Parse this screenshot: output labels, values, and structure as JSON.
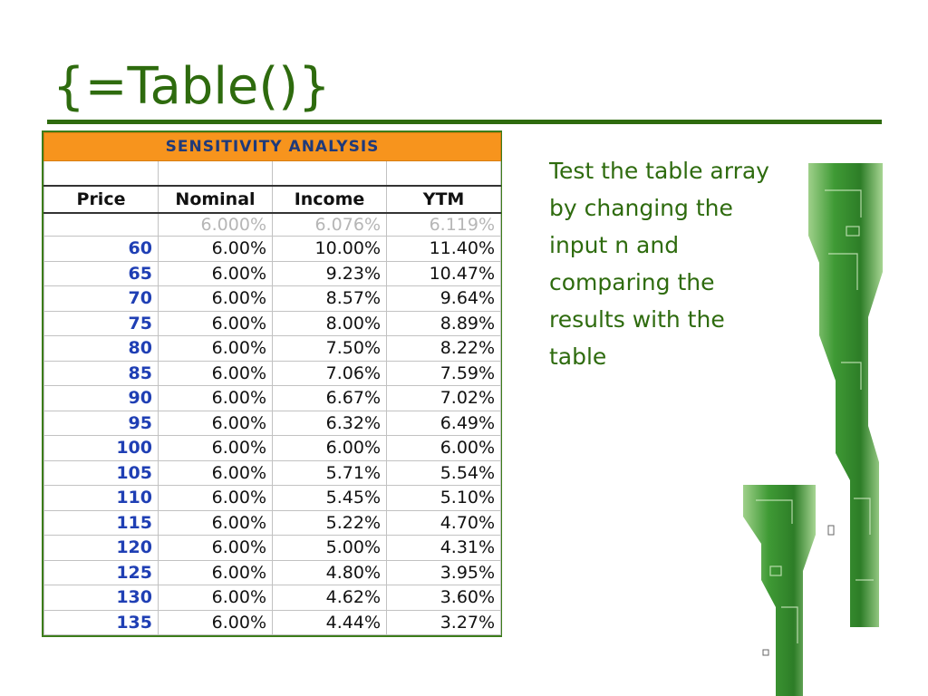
{
  "title": "{=Table()}",
  "table": {
    "banner": "SENSITIVITY ANALYSIS",
    "headers": [
      "Price",
      "Nominal",
      "Income",
      "YTM"
    ],
    "subrow": [
      "",
      "6.000%",
      "6.076%",
      "6.119%"
    ],
    "rows": [
      [
        "60",
        "6.00%",
        "10.00%",
        "11.40%"
      ],
      [
        "65",
        "6.00%",
        "9.23%",
        "10.47%"
      ],
      [
        "70",
        "6.00%",
        "8.57%",
        "9.64%"
      ],
      [
        "75",
        "6.00%",
        "8.00%",
        "8.89%"
      ],
      [
        "80",
        "6.00%",
        "7.50%",
        "8.22%"
      ],
      [
        "85",
        "6.00%",
        "7.06%",
        "7.59%"
      ],
      [
        "90",
        "6.00%",
        "6.67%",
        "7.02%"
      ],
      [
        "95",
        "6.00%",
        "6.32%",
        "6.49%"
      ],
      [
        "100",
        "6.00%",
        "6.00%",
        "6.00%"
      ],
      [
        "105",
        "6.00%",
        "5.71%",
        "5.54%"
      ],
      [
        "110",
        "6.00%",
        "5.45%",
        "5.10%"
      ],
      [
        "115",
        "6.00%",
        "5.22%",
        "4.70%"
      ],
      [
        "120",
        "6.00%",
        "5.00%",
        "4.31%"
      ],
      [
        "125",
        "6.00%",
        "4.80%",
        "3.95%"
      ],
      [
        "130",
        "6.00%",
        "4.62%",
        "3.60%"
      ],
      [
        "135",
        "6.00%",
        "4.44%",
        "3.27%"
      ]
    ]
  },
  "note": "Test the table array by changing the input n and comparing the results with the table",
  "colors": {
    "theme_green": "#2e6b0e",
    "banner_orange": "#f7941d",
    "banner_text": "#1f3a7a",
    "price_blue": "#1f3fb4",
    "subrow_gray": "#b6b6b6"
  }
}
